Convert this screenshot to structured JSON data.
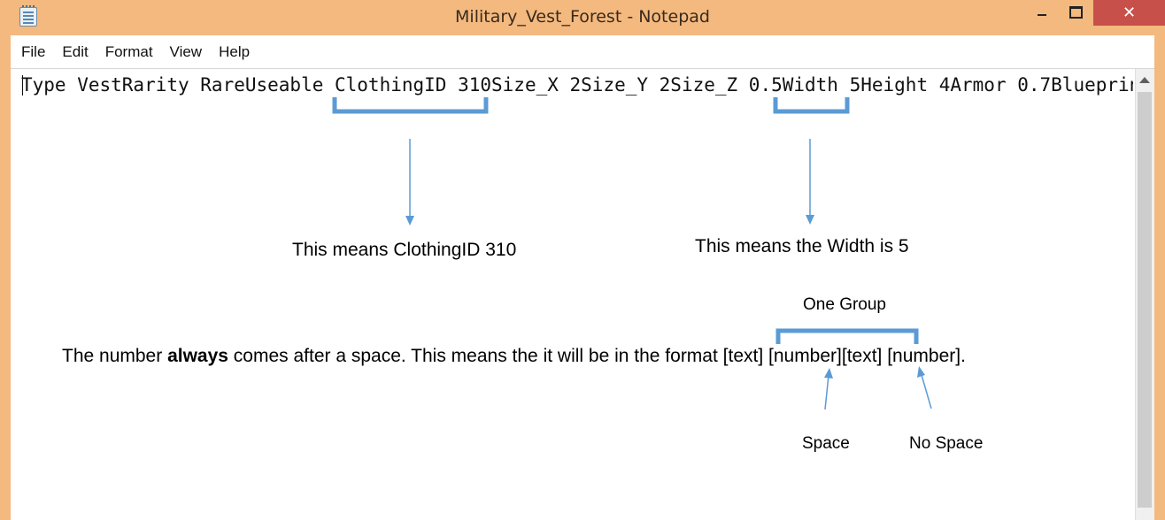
{
  "window": {
    "title": "Military_Vest_Forest - Notepad",
    "close_glyph": "✕"
  },
  "menu": [
    "File",
    "Edit",
    "Format",
    "View",
    "Help"
  ],
  "editor": {
    "text": "Type VestRarity RareUseable ClothingID 310Size_X 2Size_Y 2Size_Z 0.5Width 5Height 4Armor 0.7Blueprin"
  },
  "annotations": {
    "clothing": "This means ClothingID 310",
    "width": "This means the Width is 5",
    "group": "One Group",
    "sentence_before": "The number ",
    "sentence_bold": "always",
    "sentence_after": " comes after a space. This means the it will be in the format [text] [number][text] [number].",
    "space": "Space",
    "no_space": "No Space"
  },
  "colors": {
    "title_bar": "#f3b97f",
    "close_button": "#c7504a",
    "annotation_blue": "#5b9bd5"
  },
  "icons": [
    "notepad-icon",
    "minimize-icon",
    "maximize-icon",
    "close-icon",
    "scroll-up-icon"
  ]
}
